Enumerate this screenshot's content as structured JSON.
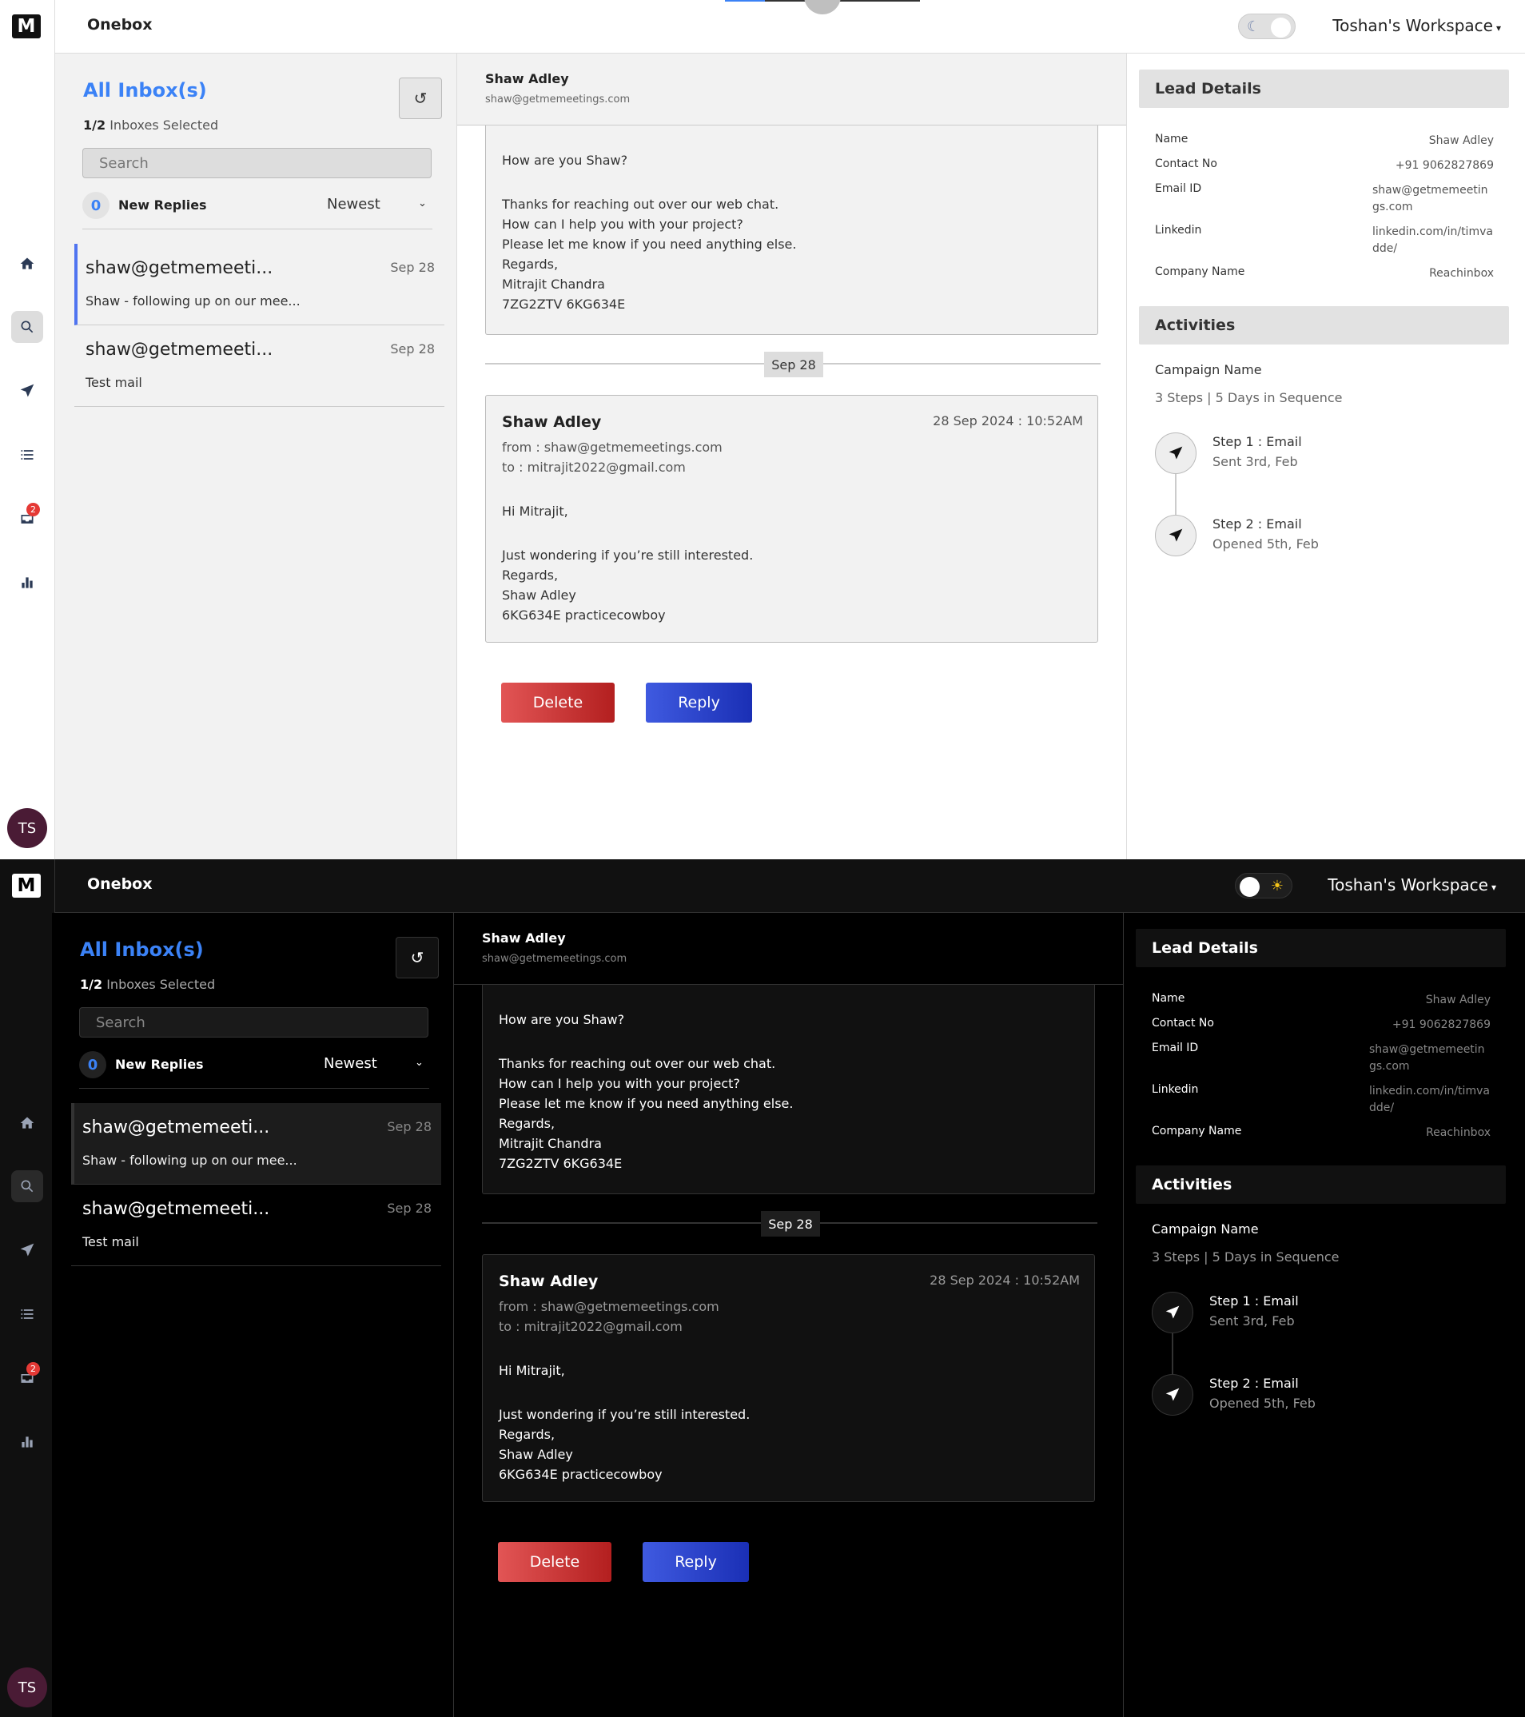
{
  "app": {
    "logo_letter": "M",
    "title": "Onebox",
    "workspace": "Toshan's Workspace",
    "avatar_initials": "TS",
    "nav": [
      {
        "name": "home",
        "icon": "home-icon"
      },
      {
        "name": "search",
        "icon": "search-icon"
      },
      {
        "name": "send",
        "icon": "send-icon"
      },
      {
        "name": "list",
        "icon": "list-icon"
      },
      {
        "name": "inbox",
        "icon": "inbox-icon",
        "badge": "2"
      },
      {
        "name": "analytics",
        "icon": "bar-chart-icon"
      }
    ],
    "theme_toggle": {
      "light_glyph": "☾",
      "dark_glyph": "☀"
    }
  },
  "inbox": {
    "title": "All Inbox(s)",
    "selected_count": "1/2",
    "selected_label": "Inboxes Selected",
    "search_placeholder": "Search",
    "new_replies_count": "0",
    "new_replies_label": "New Replies",
    "sort_value": "Newest",
    "threads": [
      {
        "from": "shaw@getmemeeti...",
        "date": "Sep 28",
        "subject": "Shaw - following up on our mee..."
      },
      {
        "from": "shaw@getmemeeti...",
        "date": "Sep 28",
        "subject": "Test mail"
      }
    ]
  },
  "conversation": {
    "name": "Shaw Adley",
    "email": "shaw@getmemeetings.com",
    "message1_lines": [
      "How are you Shaw?",
      "",
      "Thanks for reaching out over our web chat.",
      "How can I help you with your project?",
      "Please let me know if you need anything else.",
      "Regards,",
      "Mitrajit Chandra",
      "7ZG2ZTV 6KG634E"
    ],
    "divider_date": "Sep 28",
    "message2": {
      "sender": "Shaw Adley",
      "timestamp": "28 Sep 2024 : 10:52AM",
      "from": "from : shaw@getmemeetings.com",
      "to": "to : mitrajit2022@gmail.com",
      "body_lines": [
        "Hi Mitrajit,",
        "",
        "Just wondering if you’re still interested.",
        "Regards,",
        "Shaw Adley",
        "6KG634E practicecowboy"
      ]
    },
    "delete_label": "Delete",
    "reply_label": "Reply"
  },
  "lead": {
    "header": "Lead Details",
    "fields": [
      {
        "label": "Name",
        "value": "Shaw Adley"
      },
      {
        "label": "Contact No",
        "value": "+91 9062827869"
      },
      {
        "label": "Email ID",
        "value": "shaw@getmemeetings.com"
      },
      {
        "label": "Linkedin",
        "value": "linkedin.com/in/timvadde/"
      },
      {
        "label": "Company Name",
        "value": "Reachinbox"
      }
    ]
  },
  "activities": {
    "header": "Activities",
    "campaign_name": "Campaign Name",
    "campaign_steps": "3 Steps | 5 Days in Sequence",
    "steps": [
      {
        "title": "Step 1 : Email",
        "status": "Sent 3rd, Feb"
      },
      {
        "title": "Step 2 : Email",
        "status": "Opened 5th, Feb"
      }
    ]
  }
}
